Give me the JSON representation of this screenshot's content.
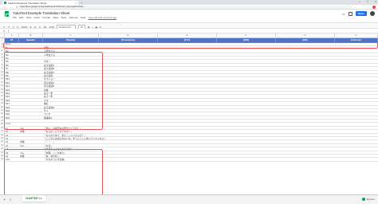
{
  "browser": {
    "tab_title": "YukaTool Example Translation Sheet",
    "tab_close": "×",
    "new_tab": "+",
    "window_controls": [
      "–",
      "□",
      "×"
    ],
    "nav_buttons": "← → ⟳",
    "url": "https://docs.google.com/spreadsheets/d/1hSnxaV_DjqvxwgNUIvfhpb..."
  },
  "app": {
    "title": "YukaTool Example Translation Sheet",
    "menus": [
      "File",
      "Edit",
      "View",
      "Insert",
      "Format",
      "Data",
      "Tools",
      "Add-ons",
      "Help"
    ],
    "last_edit": "Last edit was seconds ago",
    "share_label": "Share"
  },
  "toolbar": {
    "undo": "↶",
    "redo": "↷",
    "print": "⎙",
    "paint": "✎",
    "zoom": "100%",
    "currency": "$",
    "percent": "%",
    "dec1": ".0",
    "dec2": ".00",
    "format": "123▾",
    "font": "Default (Ari...",
    "size": "10",
    "bold": "B",
    "italic": "I",
    "strike": "S",
    "text_color": "A"
  },
  "formula_bar": {
    "fx": "fx"
  },
  "columns": [
    "A",
    "B",
    "C",
    "D",
    "E",
    "F",
    "G",
    "H"
  ],
  "header_row": {
    "row_number": "1",
    "cells": [
      "ID",
      "Speaker",
      "Original",
      "[Translation]",
      "[FLT]",
      "[GIR]",
      "[BE]",
      "Comment"
    ]
  },
  "sections": {
    "menu": {
      "title_row": "2",
      "title": "Menu",
      "rows": [
        {
          "n": "3",
          "id": "N1",
          "original": "対戦"
        },
        {
          "n": "4",
          "id": "N2",
          "original": "１年生で子"
        },
        {
          "n": "5",
          "id": "N3",
          "original": "１年生で子"
        },
        {
          "n": "6",
          "id": "N4",
          "original": "・・・"
        },
        {
          "n": "7",
          "id": "N5",
          "original": "ボタン"
        },
        {
          "n": "8",
          "id": "N6",
          "original": "女子生徒A"
        },
        {
          "n": "9",
          "id": "N7",
          "original": "女子生徒B"
        },
        {
          "n": "10",
          "id": "N8",
          "original": "女子生徒C"
        },
        {
          "n": "11",
          "id": "N9",
          "original": "女子生徒"
        },
        {
          "n": "12",
          "id": "N10",
          "original": "オプション"
        },
        {
          "n": "13",
          "id": "N11",
          "original": "男子生徒A"
        },
        {
          "n": "14",
          "id": "N12",
          "original": "男子生徒B"
        },
        {
          "n": "15",
          "id": "N13",
          "original": "先輩"
        },
        {
          "n": "16",
          "id": "N14",
          "original": "女子一年"
        },
        {
          "n": "17",
          "id": "N15",
          "original": "女子一年"
        },
        {
          "n": "18",
          "id": "N16",
          "original": "ママ"
        },
        {
          "n": "19",
          "id": "N17",
          "original": "無名"
        },
        {
          "n": "20",
          "id": "N18",
          "original": "女子生徒D"
        },
        {
          "n": "21",
          "id": "N19",
          "original": "サイ"
        },
        {
          "n": "22",
          "id": "N20",
          "original": "つくれ"
        },
        {
          "n": "23",
          "id": "N21",
          "original": "保護者A"
        }
      ]
    },
    "lines": {
      "spacer_row": "24",
      "title_row": "25",
      "title": "Lines",
      "rows": [
        {
          "n": "26",
          "id": "L1",
          "speaker": "Yuu",
          "original": "「あい、お前日向ぶ何やってるの？」"
        },
        {
          "n": "27",
          "id": "L2",
          "speaker": "対戦",
          "original": "「なんの」どうかですか？」"
        },
        {
          "n": "28",
          "id": "L3",
          "speaker": "",
          "original": "「なんのためで、まだここにいるんだ？」"
        },
        {
          "n": "29",
          "id": "L4",
          "speaker": "",
          "original": "「ここからは出られないの。ずっとここに残っていたいなら」"
        },
        {
          "n": "30",
          "id": "L5",
          "speaker": "対戦",
          "original": "「・・・」"
        },
        {
          "n": "31",
          "id": "L6",
          "speaker": "Yuu",
          "original": "「なぜ」"
        },
        {
          "n": "32",
          "id": "L7",
          "speaker": "",
          "original": "それ違うことなんだろうか？"
        },
        {
          "n": "33",
          "id": "L8",
          "speaker": "Yuu",
          "original": "「対戦、ここがあり」"
        },
        {
          "n": "34",
          "id": "L9",
          "speaker": "対戦",
          "original": "「あ、あのね。」"
        },
        {
          "n": "35",
          "id": "L10",
          "speaker": "",
          "original": "「かなかったの仕事」"
        }
      ]
    }
  },
  "sheet_tabs": {
    "add": "+",
    "list": "≡",
    "active": "CHAPTER 1 ▾",
    "explore": "Explore"
  },
  "colors": {
    "header_blue": "#4f74c5",
    "highlight_red": "#e8545c",
    "sheets_green": "#0f9d58",
    "share_blue": "#1a73e8"
  }
}
